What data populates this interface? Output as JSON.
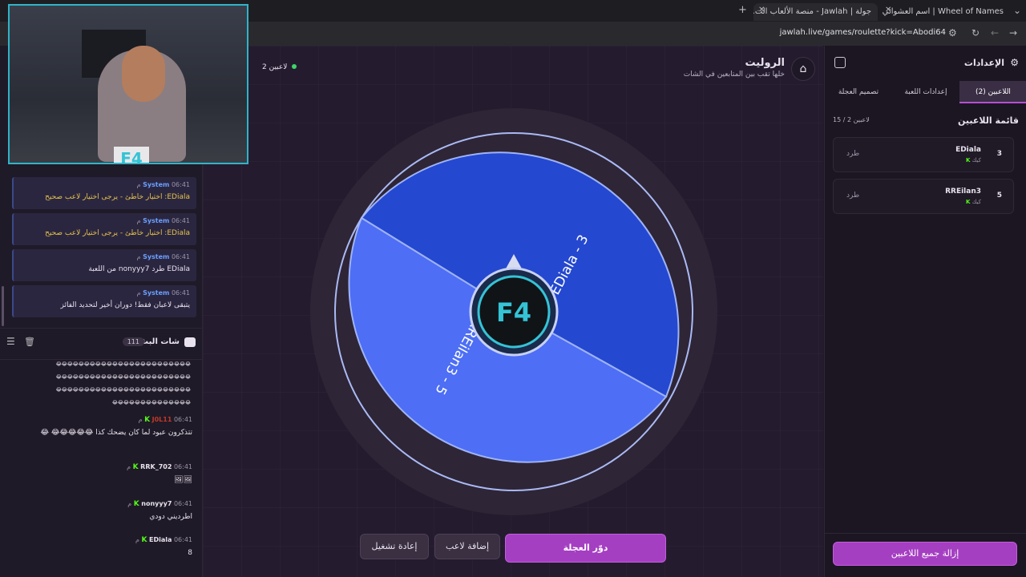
{
  "browser": {
    "tabs": [
      {
        "title": "Wheel of Names | اسم العشوائي"
      },
      {
        "title": "جولة | Jawlah - منصة الألعاب الت..."
      }
    ],
    "url": "jawlah.live/games/roulette?kick=Abodi64"
  },
  "chat": {
    "system_messages": [
      {
        "name": "System",
        "time": "06:41 م",
        "text": "EDiala: اختيار خاطئ - يرجى اختيار لاعب صحيح",
        "warn": true
      },
      {
        "name": "System",
        "time": "06:41 م",
        "text": "EDiala: اختيار خاطئ - يرجى اختيار لاعب صحيح",
        "warn": true
      },
      {
        "name": "System",
        "time": "06:41 م",
        "text": "EDiala طرد nonyyy7 من اللعبة",
        "warn": false
      },
      {
        "name": "System",
        "time": "06:41 م",
        "text": "يتبقى لاعبان فقط! دوران أخير لتحديد الفائز",
        "warn": false
      }
    ],
    "header_title": "شات البث",
    "header_count": "111",
    "spam_lines": [
      "😂😂😂😂😂😂😂😂😂😂😂😂😂😂😂😂😂😂😂😂😂😂😂😂",
      "😂😂😂😂😂😂😂😂😂😂😂😂😂😂😂😂😂😂😂😂😂😂😂😂",
      "😂😂😂😂😂😂😂😂😂😂😂😂😂😂😂😂😂😂😂😂😂😂😂😂",
      "😂😂😂😂😂😂😂😂😂😂😂😂😂😂"
    ],
    "messages": [
      {
        "user": "J0L11",
        "time": "06:41 م",
        "text": "تتذكرون عبود لما كان يضحك كذا 😂😂😂😂😂 😂",
        "user_color": "#c0392b"
      },
      {
        "user": "RRK_702",
        "time": "06:41 م",
        "text": "🖼🖼",
        "user_color": "#e8e2ee"
      },
      {
        "user": "nonyyy7",
        "time": "06:41 م",
        "text": "اطرديني دودي",
        "user_color": "#e8e2ee"
      },
      {
        "user": "EDiala",
        "time": "06:41 م",
        "text": "8",
        "user_color": "#e8e2ee"
      }
    ]
  },
  "stage": {
    "players_online": "2 لاعبين",
    "title": "الروليت",
    "subtitle": "خلها تقب بين المتابعين في الشات",
    "wheel": {
      "segments": [
        {
          "label": "EDiala - 3",
          "color": "#2448d0"
        },
        {
          "label": "RREilan3 - 5",
          "color": "#4d6ef5"
        }
      ],
      "center_logo": "F4"
    },
    "buttons": {
      "spin": "دوّر العجلة",
      "add_player": "إضافة لاعب",
      "restart": "إعادة تشغيل"
    }
  },
  "settings": {
    "title": "الإعدادات",
    "tabs": [
      "اللاعبين (2)",
      "إعدادات اللعبة",
      "تصميم العجلة"
    ],
    "list_title": "قائمة اللاعبين",
    "count": "15 / 2 لاعبين",
    "players": [
      {
        "number": "3",
        "name": "EDiala",
        "platform": "كيك",
        "action": "طرد"
      },
      {
        "number": "5",
        "name": "RREilan3",
        "platform": "كيك",
        "action": "طرد"
      }
    ],
    "remove_all": "إزالة جميع اللاعبين"
  }
}
